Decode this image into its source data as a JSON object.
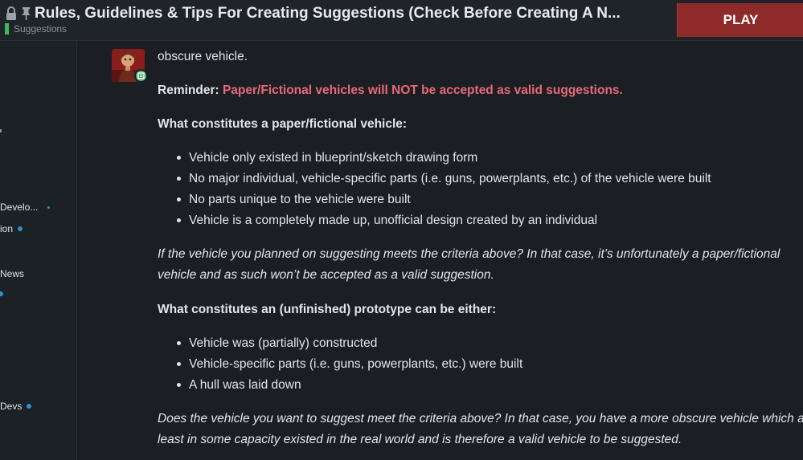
{
  "header": {
    "title": "Rules, Guidelines & Tips For Creating Suggestions (Check Before Creating A N...",
    "category": "Suggestions",
    "category_color": "#3db85f",
    "play_label": "PLAY"
  },
  "sidebar": {
    "items": [
      {
        "label": "Develo..."
      },
      {
        "label": "ion"
      },
      {
        "label": "News"
      },
      {
        "label": "Devs"
      }
    ]
  },
  "post": {
    "intro_tail": "obscure vehicle.",
    "reminder_label": "Reminder:",
    "reminder_text": "Paper/Fictional vehicles will NOT be accepted as valid suggestions.",
    "paper_heading": "What constitutes a paper/fictional vehicle:",
    "paper_items": [
      "Vehicle only existed in blueprint/sketch drawing form",
      "No major individual, vehicle-specific parts (i.e. guns, powerplants, etc.) of the vehicle were built",
      "No parts unique to the vehicle were built",
      "Vehicle is a completely made up, unofficial design created by an individual"
    ],
    "paper_note_line1": "If the vehicle you planned on suggesting meets the criteria above? In that case, it’s unfortunately a paper/fictional",
    "paper_note_line2": "vehicle and as such won’t be accepted as a valid suggestion.",
    "proto_heading": "What constitutes an (unfinished) prototype can be either:",
    "proto_items": [
      "Vehicle was (partially) constructed",
      "Vehicle-specific parts (i.e. guns, powerplants, etc.) were built",
      "A hull was laid down"
    ],
    "proto_note_line1": "Does the vehicle you want to suggest meet the criteria above? In that case, you have a more obscure vehicle which at",
    "proto_note_line2": "least in some capacity existed in the real world and is therefore a valid vehicle to be suggested."
  },
  "colors": {
    "accent_play": "#8e2a2a",
    "reminder_red": "#e8687a",
    "unread_dot": "#2f8fcc"
  }
}
